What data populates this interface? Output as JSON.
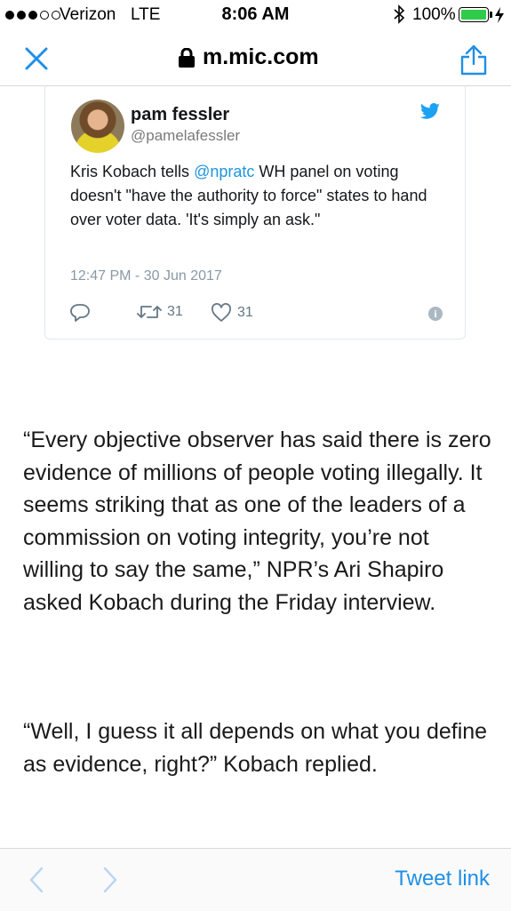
{
  "status_bar": {
    "carrier": "Verizon",
    "network": "LTE",
    "time": "8:06 AM",
    "battery_percent": "100%",
    "signal_bars_filled": 3,
    "signal_bars_total": 5
  },
  "nav": {
    "url": "m.mic.com",
    "icons": [
      "close-icon",
      "lock-icon",
      "share-icon"
    ]
  },
  "tweet": {
    "author_name": "pam fessler",
    "handle": "@pamelafessler",
    "text_before_mention": "Kris Kobach tells ",
    "mention": "@npratc",
    "text_after_mention": " WH panel on voting doesn't \"have the authority to force\" states to hand over voter data. 'It's simply an ask.\"",
    "timestamp": "12:47 PM - 30 Jun 2017",
    "retweet_count": "31",
    "like_count": "31",
    "brand_color": "#1da1f2"
  },
  "article": {
    "paragraph_1": "“Every objective observer has said there is zero evidence of millions of people voting illegally. It seems striking that as one of the leaders of a commission on voting integrity, you’re not willing to say the same,” NPR’s Ari Shapiro asked Kobach during the Friday interview.",
    "paragraph_2": "“Well, I guess it all depends on what you define as evidence, right?” Kobach replied."
  },
  "toolbar": {
    "tweet_link_label": "Tweet link",
    "accent_color": "#1f8fe6"
  }
}
